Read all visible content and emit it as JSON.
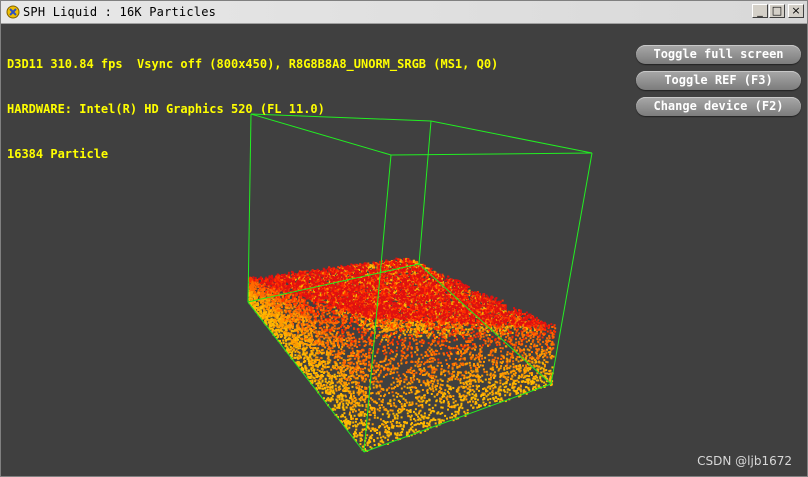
{
  "window": {
    "title": "SPH Liquid : 16K Particles",
    "controls": {
      "minimize": "_",
      "maximize": "□",
      "close": "×"
    },
    "icon": "app-x-icon"
  },
  "hud": {
    "stats_line1": "D3D11 310.84 fps  Vsync off (800x450), R8G8B8A8_UNORM_SRGB (MS1, Q0)",
    "stats_line2": "HARDWARE: Intel(R) HD Graphics 520 (FL 11.0)",
    "stats_line3": "16384 Particle",
    "text_color": "#ffff00"
  },
  "buttons": {
    "fullscreen": "Toggle full screen",
    "ref": "Toggle REF (F3)",
    "device": "Change device (F2)"
  },
  "scene": {
    "background": "#404040",
    "box_color": "#22ee22",
    "particle_colors": [
      "#e01010",
      "#ff3000",
      "#ff6a00",
      "#ff9a00",
      "#ffb800"
    ]
  },
  "watermark": "CSDN @ljb1672"
}
